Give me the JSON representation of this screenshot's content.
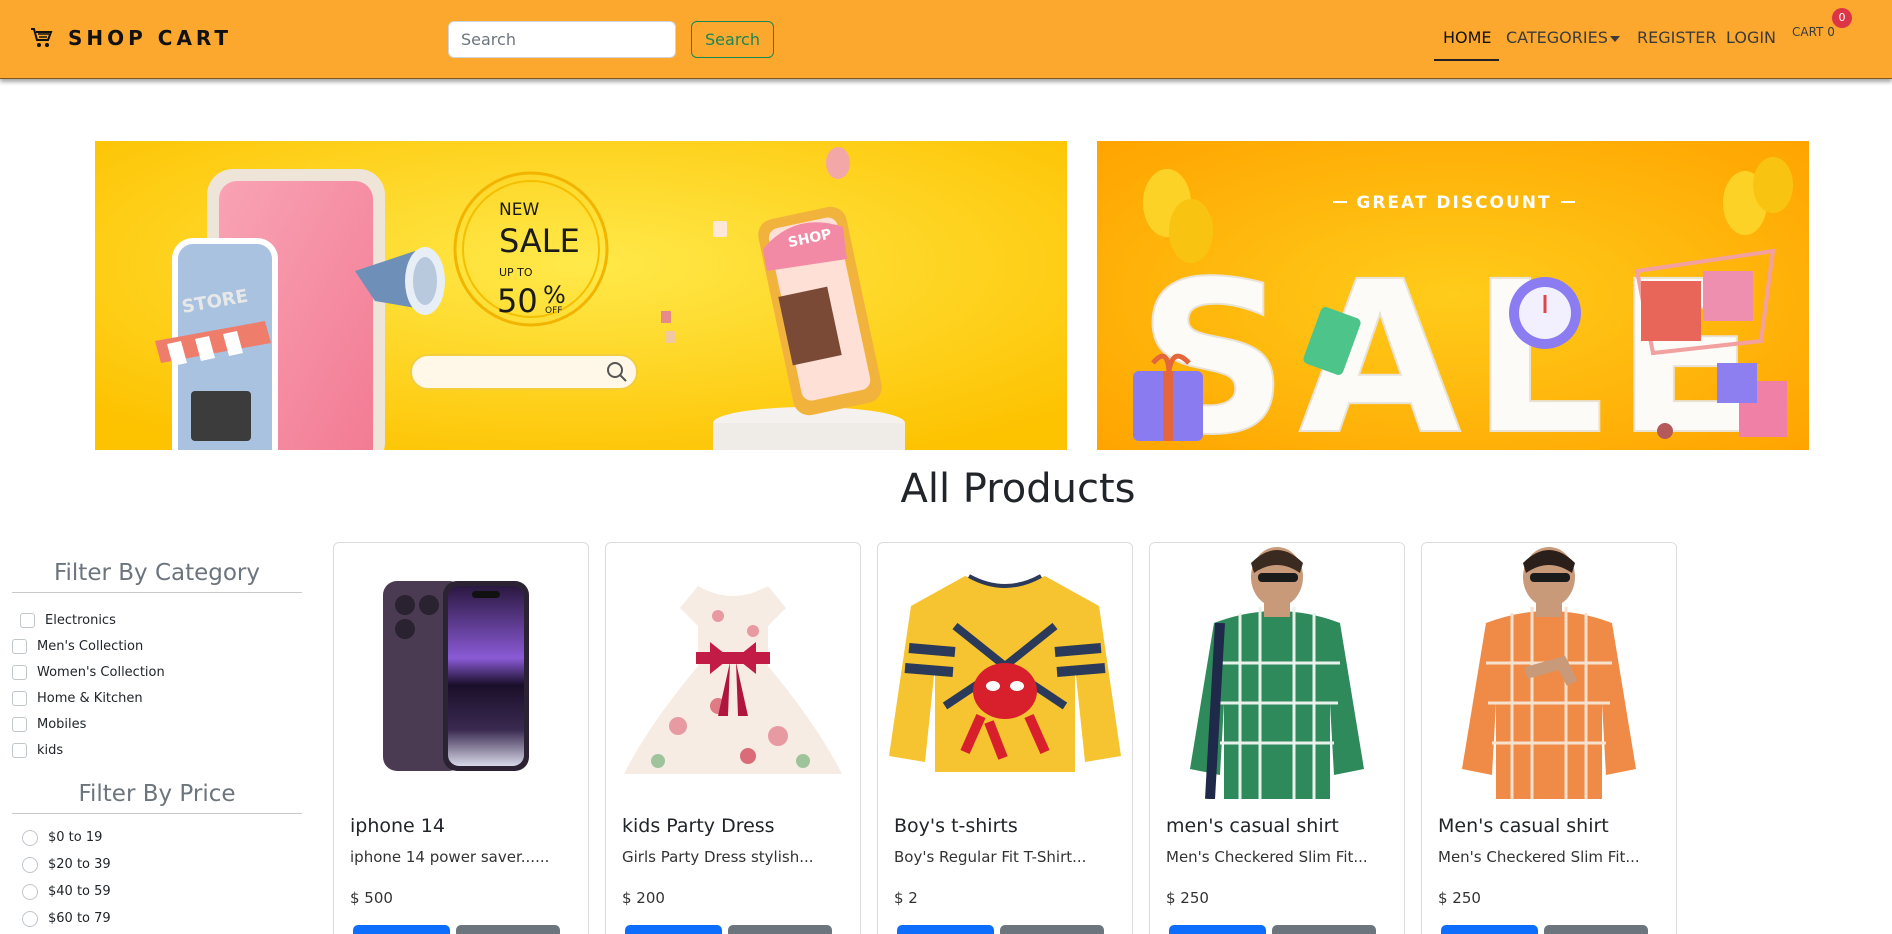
{
  "navbar": {
    "brand": "SHOP CART",
    "brand_icon": "shopping-cart-icon",
    "search_placeholder": "Search",
    "search_button": "Search",
    "links": [
      "HOME",
      "CATEGORIES",
      "REGISTER",
      "LOGIN"
    ],
    "active_link": "HOME",
    "cart_label": "CART 0",
    "cart_count": "0",
    "bg_color": "#fca82e"
  },
  "banners": {
    "left": {
      "store_sign": "STORE",
      "shop_sign": "SHOP",
      "new": "NEW",
      "sale": "SALE",
      "up_to": "UP TO",
      "percent": "50",
      "percent_sign": "%",
      "off": "OFF"
    },
    "right": {
      "great_discount": "GREAT DISCOUNT",
      "sale": "SALE"
    }
  },
  "page_title": "All Products",
  "filters": {
    "category_title": "Filter By Category",
    "categories": [
      "Electronics",
      "Men's Collection",
      "Women's Collection",
      "Home & Kitchen",
      "Mobiles",
      "kids"
    ],
    "price_title": "Filter By Price",
    "prices": [
      "$0 to 19",
      "$20 to 39",
      "$40 to 59",
      "$60 to 79"
    ]
  },
  "products": [
    {
      "title": "iphone 14",
      "desc": "iphone 14 power saver......",
      "price": "$ 500",
      "image": "iphone-image"
    },
    {
      "title": "kids Party Dress",
      "desc": "Girls Party Dress stylish...",
      "price": "$ 200",
      "image": "dress-image"
    },
    {
      "title": "Boy's t-shirts",
      "desc": "Boy's Regular Fit T-Shirt...",
      "price": "$ 2",
      "image": "tshirt-image"
    },
    {
      "title": "men's casual shirt",
      "desc": "Men's Checkered Slim Fit...",
      "price": "$ 250",
      "image": "green-shirt-image"
    },
    {
      "title": "Men's casual shirt",
      "desc": "Men's Checkered Slim Fit...",
      "price": "$ 250",
      "image": "orange-shirt-image"
    }
  ]
}
